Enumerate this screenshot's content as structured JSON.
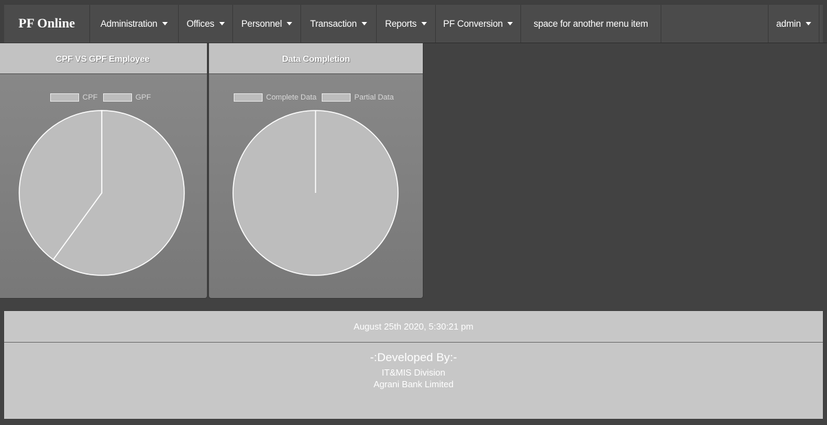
{
  "navbar": {
    "brand": "PF Online",
    "items": [
      {
        "label": "Administration",
        "dropdown": true
      },
      {
        "label": "Offices",
        "dropdown": true
      },
      {
        "label": "Personnel",
        "dropdown": true
      },
      {
        "label": "Transaction",
        "dropdown": true
      },
      {
        "label": "Reports",
        "dropdown": true
      },
      {
        "label": "PF Conversion",
        "dropdown": true
      },
      {
        "label": "space for another menu item",
        "dropdown": false
      }
    ],
    "user": "admin"
  },
  "chart_data": [
    {
      "type": "pie",
      "title": "CPF VS GPF Employee",
      "legend": [
        "CPF",
        "GPF"
      ],
      "legend_position": "top",
      "values": [
        60,
        40
      ],
      "colors": [
        "#bdbdbd",
        "#bdbdbd"
      ]
    },
    {
      "type": "pie",
      "title": "Data Completion",
      "legend": [
        "Complete Data",
        "Partial Data"
      ],
      "legend_position": "top",
      "values": [
        100,
        0
      ],
      "colors": [
        "#bdbdbd",
        "#bdbdbd"
      ]
    }
  ],
  "footer": {
    "timestamp": "August 25th 2020, 5:30:21 pm",
    "developed_by": "-:Developed By:-",
    "division": "IT&MIS Division",
    "company": "Agrani Bank Limited"
  }
}
